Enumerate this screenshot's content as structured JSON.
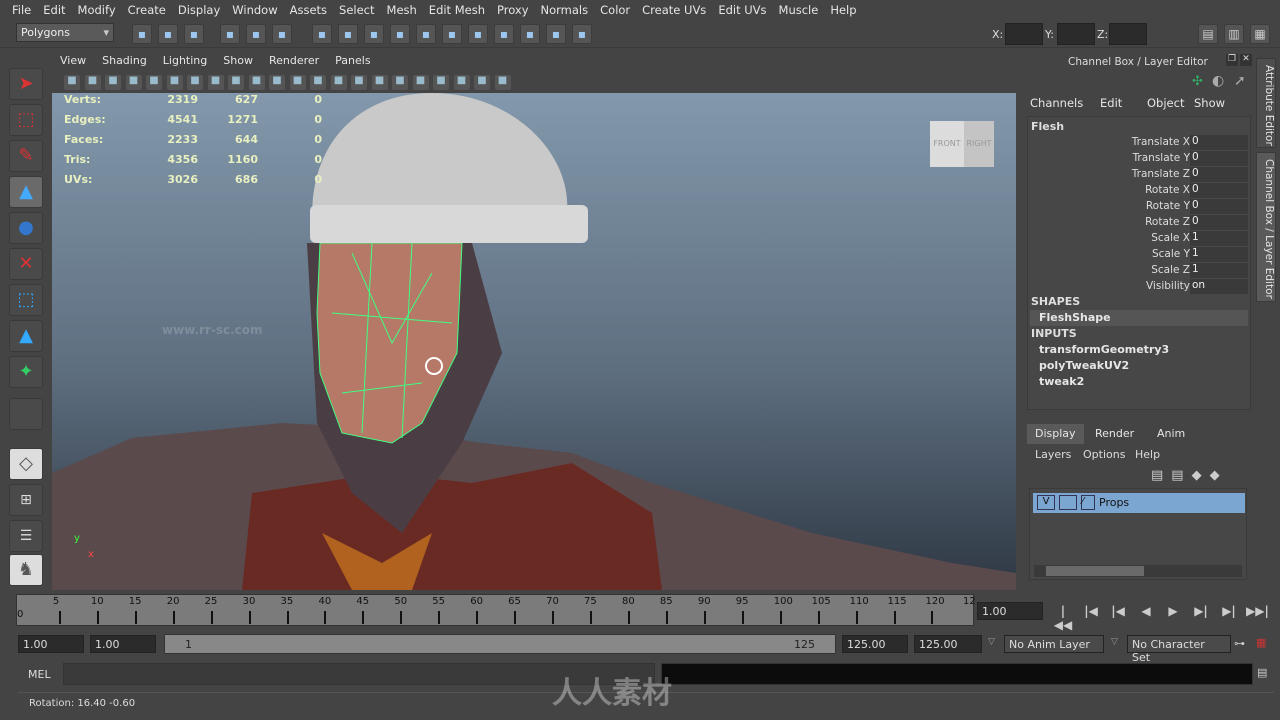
{
  "menubar": [
    "File",
    "Edit",
    "Modify",
    "Create",
    "Display",
    "Window",
    "Assets",
    "Select",
    "Mesh",
    "Edit Mesh",
    "Proxy",
    "Normals",
    "Color",
    "Create UVs",
    "Edit UVs",
    "Muscle",
    "Help"
  ],
  "status_line": {
    "mode": "Polygons",
    "x_label": "X:",
    "y_label": "Y:",
    "z_label": "Z:",
    "x_value": "",
    "y_value": "",
    "z_value": ""
  },
  "panel_menu": [
    "View",
    "Shading",
    "Lighting",
    "Show",
    "Renderer",
    "Panels"
  ],
  "heads_up": {
    "rows": [
      {
        "label": "Verts:",
        "total": "2319",
        "selected": "627",
        "uv": "0"
      },
      {
        "label": "Edges:",
        "total": "4541",
        "selected": "1271",
        "uv": "0"
      },
      {
        "label": "Faces:",
        "total": "2233",
        "selected": "644",
        "uv": "0"
      },
      {
        "label": "Tris:",
        "total": "4356",
        "selected": "1160",
        "uv": "0"
      },
      {
        "label": "UVs:",
        "total": "3026",
        "selected": "686",
        "uv": "0"
      }
    ]
  },
  "viewcube": {
    "front": "FRONT",
    "right": "RIGHT"
  },
  "axis": {
    "x": "x",
    "y": "y"
  },
  "channel_box": {
    "title": "Channel Box / Layer Editor",
    "menu": [
      "Channels",
      "Edit",
      "Object",
      "Show"
    ],
    "object": "Flesh",
    "channels": [
      {
        "name": "Translate X",
        "value": "0"
      },
      {
        "name": "Translate Y",
        "value": "0"
      },
      {
        "name": "Translate Z",
        "value": "0"
      },
      {
        "name": "Rotate X",
        "value": "0"
      },
      {
        "name": "Rotate Y",
        "value": "0"
      },
      {
        "name": "Rotate Z",
        "value": "0"
      },
      {
        "name": "Scale X",
        "value": "1"
      },
      {
        "name": "Scale Y",
        "value": "1"
      },
      {
        "name": "Scale Z",
        "value": "1"
      },
      {
        "name": "Visibility",
        "value": "on"
      }
    ],
    "shapes_label": "SHAPES",
    "shapes": [
      "FleshShape"
    ],
    "inputs_label": "INPUTS",
    "inputs": [
      "transformGeometry3",
      "polyTweakUV2",
      "tweak2"
    ]
  },
  "side_tabs": [
    "Attribute Editor",
    "Channel Box / Layer Editor"
  ],
  "layer_editor": {
    "tabs": [
      "Display",
      "Render",
      "Anim"
    ],
    "active_tab": "Display",
    "menu": [
      "Layers",
      "Options",
      "Help"
    ],
    "layers": [
      {
        "visible": "V",
        "name": "Props"
      }
    ]
  },
  "timeline": {
    "ticks": [
      5,
      10,
      15,
      20,
      25,
      30,
      35,
      40,
      45,
      50,
      55,
      60,
      65,
      70,
      75,
      80,
      85,
      90,
      95,
      100,
      105,
      110,
      115,
      120
    ],
    "last_label": "12",
    "start_label": "0",
    "current_frame": "1.00"
  },
  "range": {
    "start": "1.00",
    "playback_start": "1.00",
    "slider_start": "1",
    "slider_end": "125",
    "playback_end": "125.00",
    "end": "125.00",
    "anim_layer": "No Anim Layer",
    "character_set": "No Character Set"
  },
  "command_line": {
    "lang": "MEL",
    "value": ""
  },
  "help_line": "Rotation:  16.40   -0.60",
  "watermark": {
    "url": "www.rr-sc.com",
    "brand": "人人素材"
  },
  "colors": {
    "wireframe": "#40ff80",
    "accent": "#6a9fd4",
    "layer_selected": "#7ca6d2"
  }
}
